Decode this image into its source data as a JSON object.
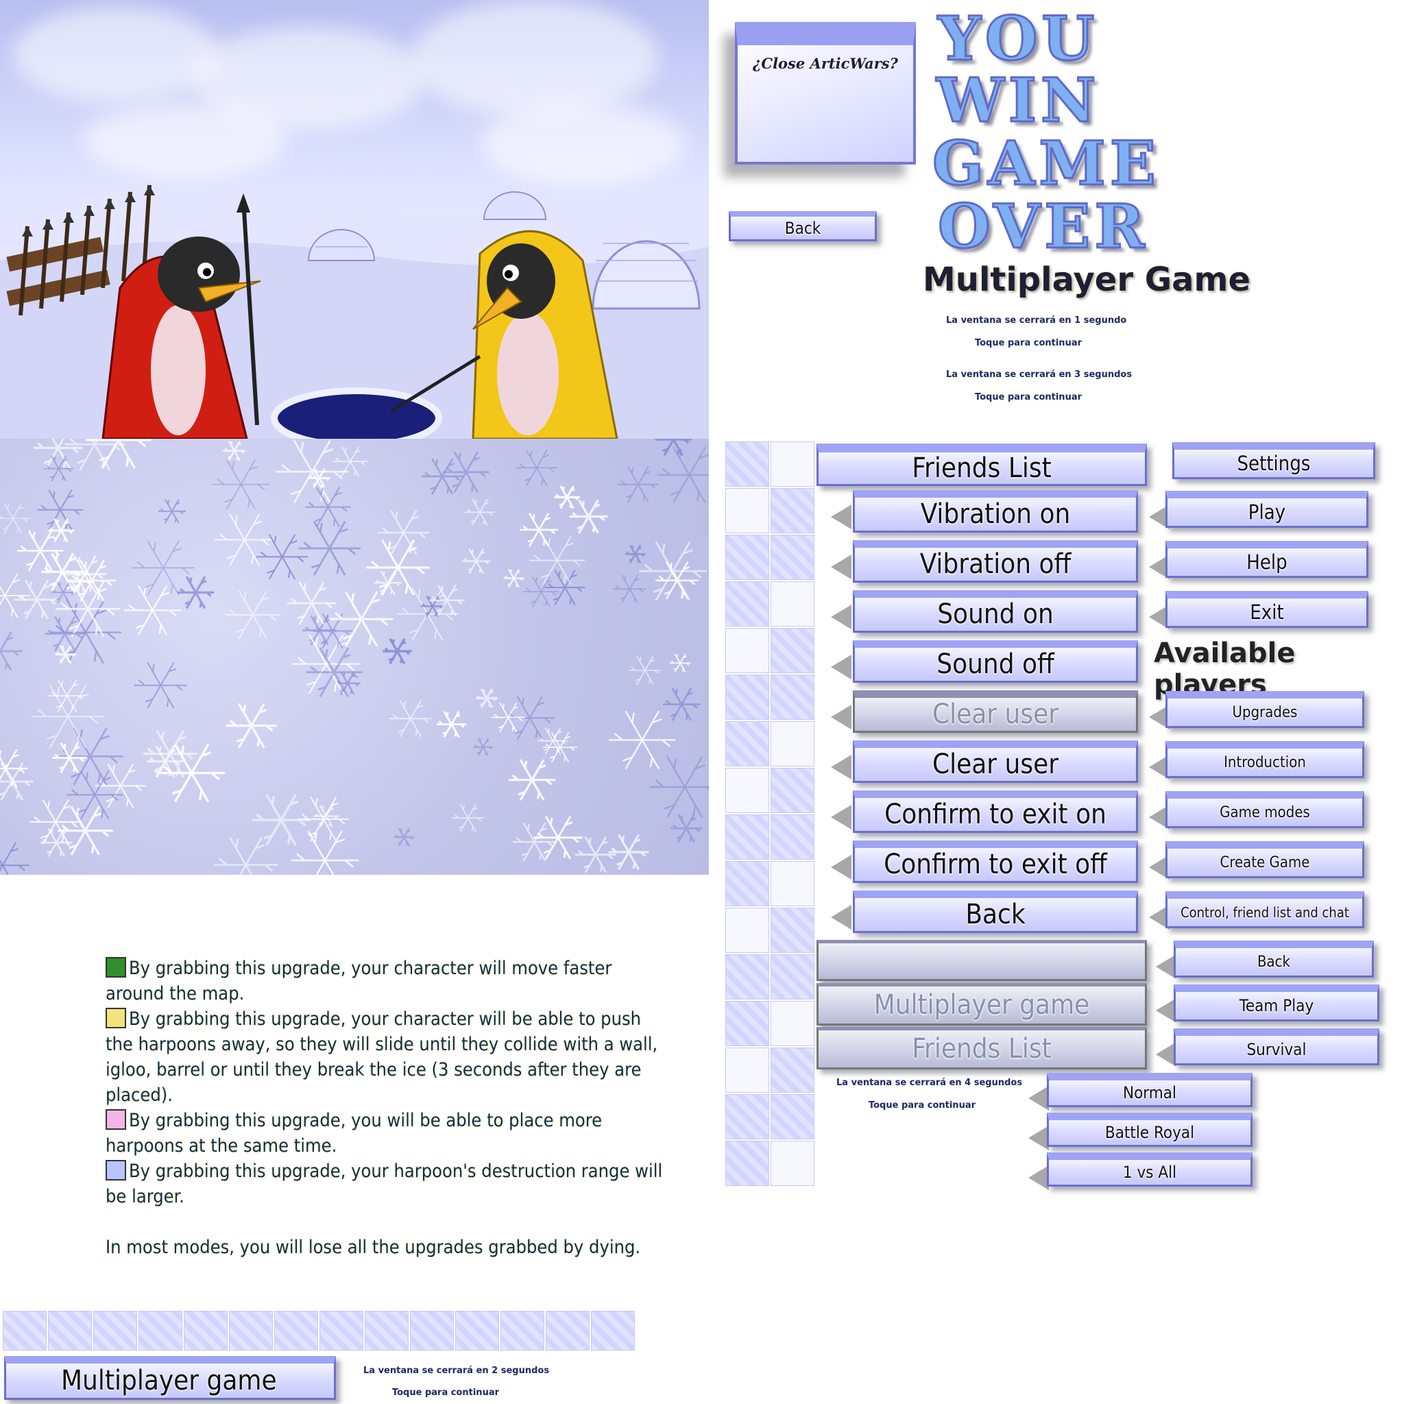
{
  "close_dialog": {
    "title": "¿Close ArticWars?"
  },
  "back_small": "Back",
  "game_over": {
    "you": "YOU",
    "win": "WIN",
    "game": "GAME",
    "over": "OVER",
    "subtitle": "Multiplayer Game",
    "notes": [
      "La ventana se cerrará en 1 segundo",
      "Toque para continuar",
      "La ventana se cerrará en 3 segundos",
      "Toque para continuar"
    ]
  },
  "options_menu": {
    "header": "Friends List",
    "items": [
      "Vibration on",
      "Vibration off",
      "Sound on",
      "Sound off",
      "Clear user",
      "Clear user",
      "Confirm to exit on",
      "Confirm to exit off",
      "Back"
    ],
    "multiplayer": "Multiplayer game",
    "friends": "Friends List",
    "notes": [
      "La ventana se cerrará en 4 segundos",
      "Toque para continuar"
    ]
  },
  "main_menu": {
    "items": [
      "Settings",
      "Play",
      "Help",
      "Exit"
    ],
    "available": "Available players",
    "items2": [
      "Upgrades",
      "Introduction",
      "Game modes",
      "Create Game",
      "Control, friend list and chat",
      "Back",
      "Team Play",
      "Survival"
    ]
  },
  "modes": [
    "Normal",
    "Battle Royal",
    "1 vs All"
  ],
  "help_text": {
    "lines": [
      "By grabbing this upgrade, your character will move faster around the map.",
      "By grabbing this upgrade, your character will be able to push the harpoons away, so they will slide until they collide with a wall, igloo, barrel or until they break the ice (3 seconds after they are placed).",
      "By grabbing this upgrade, you will be able to place more harpoons at the same time.",
      "By grabbing this upgrade, your harpoon's destruction range will be larger."
    ],
    "footer": "In most modes, you will lose all the upgrades grabbed by dying."
  },
  "bottom": {
    "button": "Multiplayer game",
    "notes": [
      "La ventana se cerrará en 2 segundos",
      "Toque para continuar"
    ]
  },
  "colors": {
    "button_border": "#6a6fd0",
    "button_top": "#9ea3f4",
    "title_fill": "#7fb0f2",
    "text_navy": "#0b2b57"
  },
  "icons": [
    "speed-upgrade-icon",
    "push-upgrade-icon",
    "more-harpoons-icon",
    "range-upgrade-icon"
  ]
}
